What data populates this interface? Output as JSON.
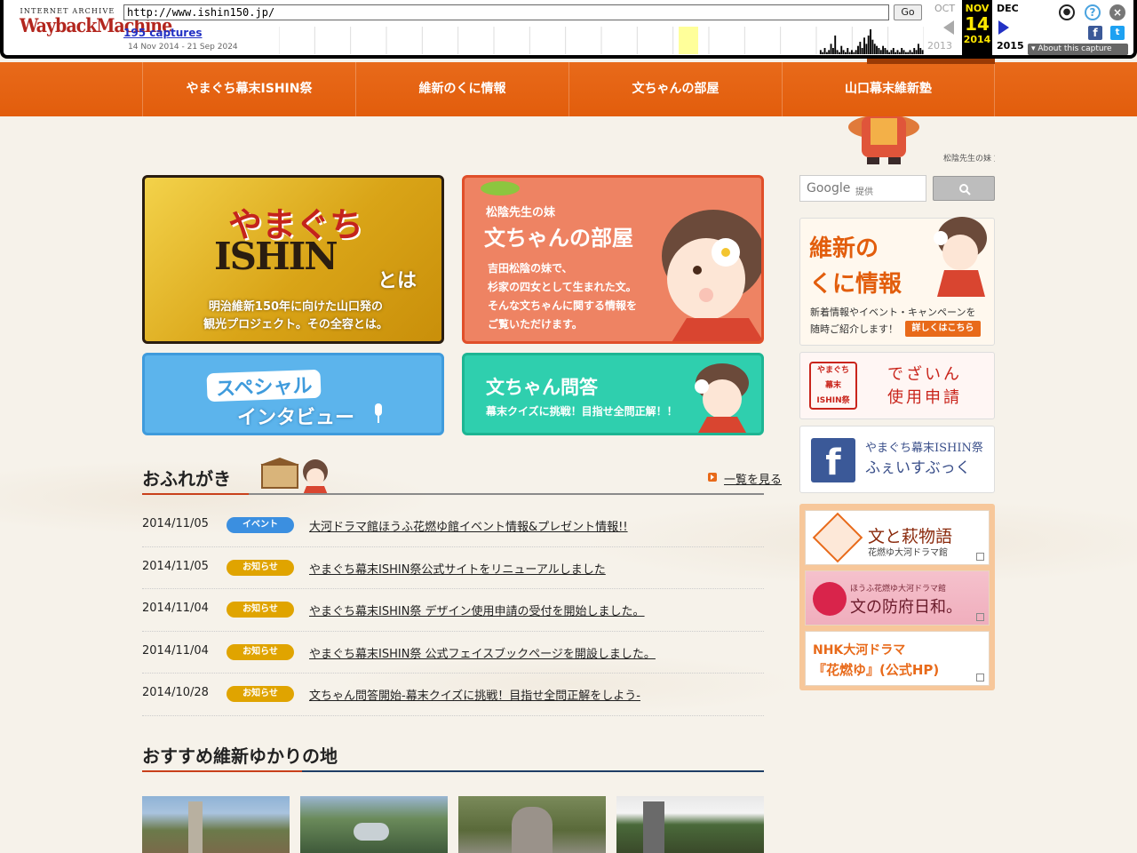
{
  "wayback": {
    "logo_top": "INTERNET ARCHIVE",
    "logo_main": "WaybackMachine",
    "url": "http://www.ishin150.jp/",
    "go_label": "Go",
    "captures_label": "195 captures",
    "range": "14 Nov 2014 - 21 Sep 2024",
    "prev_month": "OCT",
    "cur_month": "NOV",
    "cur_day": "14",
    "cur_year": "2014",
    "next_month": "DEC",
    "prev_year": "2013",
    "next_year": "2015",
    "about_label": "About this capture",
    "sparkline": [
      0,
      0,
      0,
      0,
      0,
      0,
      0,
      0,
      0,
      0,
      0,
      0,
      0,
      0,
      0,
      0,
      0,
      0,
      0,
      0,
      0,
      0,
      0,
      0,
      0,
      0,
      0,
      0,
      0,
      0,
      0,
      0,
      0,
      0,
      0,
      0,
      0,
      0,
      0,
      0,
      0,
      0,
      0,
      0,
      0,
      0,
      0,
      0,
      0,
      0,
      0,
      0,
      0,
      0,
      0,
      0,
      0,
      0,
      0,
      0,
      0,
      0,
      0,
      0,
      0,
      0,
      0,
      0,
      0,
      0,
      0,
      0,
      0,
      0,
      0,
      0,
      0,
      0,
      0,
      0,
      0,
      0,
      0,
      0,
      0,
      0,
      0,
      0,
      0,
      0,
      0,
      0,
      0,
      0,
      0,
      0,
      0,
      0,
      0,
      0,
      0,
      0,
      0,
      0,
      0,
      0,
      0,
      0,
      0,
      0,
      0,
      0,
      0,
      0,
      0,
      0,
      0,
      0,
      0,
      0,
      0,
      0,
      0,
      0,
      0,
      0,
      0,
      0,
      0,
      0,
      0,
      0,
      0,
      0,
      0,
      0,
      0,
      0,
      0,
      0,
      0,
      0,
      0,
      0,
      0,
      0,
      0,
      0,
      0,
      0,
      0,
      0,
      0,
      0,
      0,
      0,
      0,
      0,
      0,
      0,
      0,
      0,
      0,
      0,
      0,
      0,
      0,
      0,
      0,
      0,
      0,
      0,
      0,
      0,
      0,
      0,
      0,
      0,
      0,
      0,
      0,
      0,
      0,
      0,
      0,
      0,
      0,
      0,
      0,
      0,
      0,
      0,
      0,
      0,
      0,
      0,
      0,
      0,
      0,
      0,
      0,
      0,
      0,
      0,
      0,
      0,
      0,
      0,
      0,
      0,
      0,
      0,
      0,
      0,
      0,
      0,
      0,
      0,
      0,
      0,
      0,
      0,
      0,
      0,
      0,
      0,
      0,
      0,
      0,
      0,
      0,
      0,
      0,
      0,
      0,
      0,
      0,
      0,
      0,
      0,
      0,
      0,
      0,
      0,
      0,
      0,
      0,
      0,
      0,
      0,
      0,
      0,
      0,
      0,
      0,
      0,
      0,
      0,
      0,
      0,
      2,
      1,
      3,
      1,
      2,
      5,
      3,
      9,
      2,
      1,
      4,
      2,
      1,
      3,
      1,
      2,
      1,
      2,
      4,
      6,
      3,
      8,
      5,
      9,
      12,
      7,
      5,
      4,
      3,
      2,
      4,
      3,
      2,
      1,
      2,
      3,
      1,
      2,
      1,
      3,
      2,
      1,
      1,
      2,
      1,
      3,
      2,
      5,
      3,
      2
    ]
  },
  "nav": {
    "items": [
      "やまぐち幕末ISHIN祭",
      "維新のくに情報",
      "文ちゃんの部屋",
      "山口幕末維新塾"
    ]
  },
  "header": {
    "char_caption": "松陰先生の妹 文ちゃん"
  },
  "banners": {
    "b1": {
      "title": "やまぐち",
      "ishin": "ISHIN",
      "toha": "とは",
      "sub_line1": "明治維新150年に向けた山口発の",
      "sub_line2": "観光プロジェクト。その全容とは。"
    },
    "b2": {
      "sub": "松陰先生の妹",
      "title": "文ちゃんの部屋",
      "desc_line1": "吉田松陰の妹で、",
      "desc_line2": "杉家の四女として生まれた文。",
      "desc_line3": "そんな文ちゃんに関する情報を",
      "desc_line4": "ご覧いただけます。"
    },
    "b3": {
      "title": "スペシャル",
      "sub": "インタビュー"
    },
    "b4": {
      "title": "文ちゃん問答",
      "sub": "幕末クイズに挑戦！目指せ全問正解！！"
    }
  },
  "news": {
    "title": "おふれがき",
    "more_label": "一覧を見る",
    "items": [
      {
        "date": "2014/11/05",
        "badge": "イベント",
        "badge_color": "#3b8fe0",
        "text": "大河ドラマ館ほうふ花燃ゆ館イベント情報&プレゼント情報!!"
      },
      {
        "date": "2014/11/05",
        "badge": "お知らせ",
        "badge_color": "#e0a400",
        "text": "やまぐち幕末ISHIN祭公式サイトをリニューアルしました"
      },
      {
        "date": "2014/11/04",
        "badge": "お知らせ",
        "badge_color": "#e0a400",
        "text": "やまぐち幕末ISHIN祭 デザイン使用申請の受付を開始しました。"
      },
      {
        "date": "2014/11/04",
        "badge": "お知らせ",
        "badge_color": "#e0a400",
        "text": "やまぐち幕末ISHIN祭 公式フェイスブックページを開設しました。"
      },
      {
        "date": "2014/10/28",
        "badge": "お知らせ",
        "badge_color": "#e0a400",
        "text": "文ちゃん問答開始-幕末クイズに挑戦！目指せ全問正解をしよう-"
      }
    ]
  },
  "recommend": {
    "title": "おすすめ維新ゆかりの地"
  },
  "sidebar": {
    "search_brand": "Google",
    "search_prov": "提供",
    "kuni": {
      "title_line1": "維新の",
      "title_line2": "くに情報",
      "desc_line1": "新着情報やイベント・キャンペーンを",
      "desc_line2": "随時ご紹介します！",
      "button": "詳しくはこちら"
    },
    "design": {
      "line1": "でざいん",
      "line2": "使用申請"
    },
    "facebook": {
      "line1": "やまぐち幕末ISHIN祭",
      "line2": "ふぇいすぶっく"
    },
    "links": [
      {
        "t1": "文と萩物語",
        "t2": "花燃ゆ大河ドラマ館"
      },
      {
        "t1": "ほうふ花燃ゆ大河ドラマ館",
        "t2": "文の防府日和。"
      },
      {
        "t1": "NHK大河ドラマ",
        "t2": "『花燃ゆ』(公式HP)"
      }
    ]
  },
  "colors": {
    "nav": "#e86a1a",
    "accent_red": "#c9401b",
    "event_badge": "#3b8fe0",
    "notice_badge": "#e0a400"
  }
}
